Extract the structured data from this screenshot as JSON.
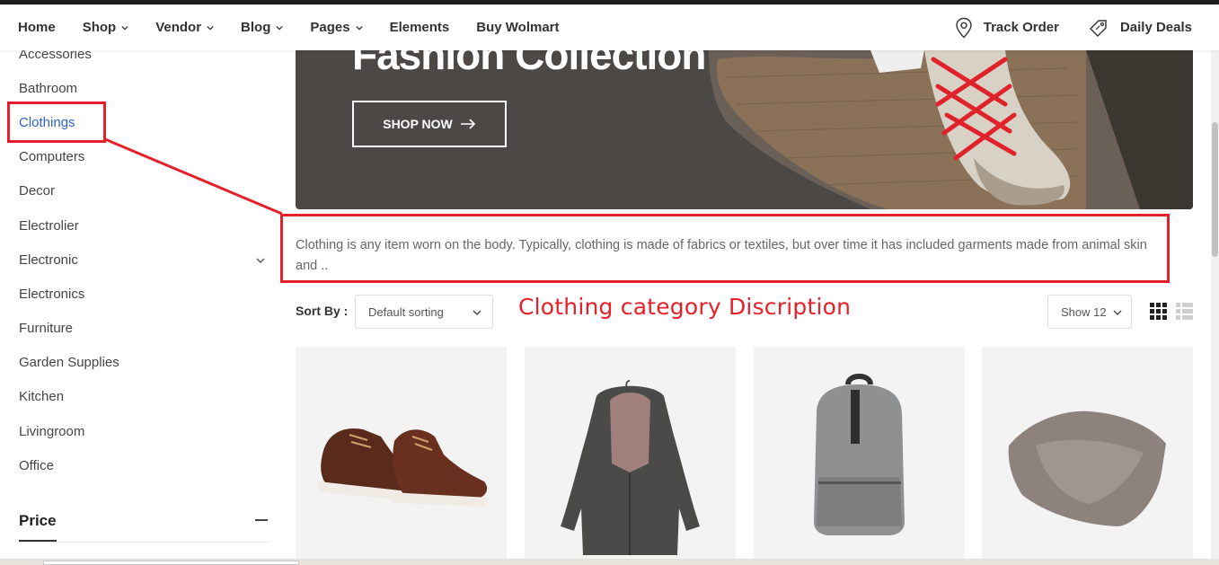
{
  "nav": {
    "items": [
      {
        "label": "Home",
        "has_dropdown": false
      },
      {
        "label": "Shop",
        "has_dropdown": true
      },
      {
        "label": "Vendor",
        "has_dropdown": true
      },
      {
        "label": "Blog",
        "has_dropdown": true
      },
      {
        "label": "Pages",
        "has_dropdown": true
      },
      {
        "label": "Elements",
        "has_dropdown": false
      },
      {
        "label": "Buy Wolmart",
        "has_dropdown": false
      }
    ],
    "track_order": "Track Order",
    "daily_deals": "Daily Deals"
  },
  "sidebar": {
    "categories": [
      {
        "label": "Accessories"
      },
      {
        "label": "Bathroom"
      },
      {
        "label": "Clothings",
        "active": true
      },
      {
        "label": "Computers"
      },
      {
        "label": "Decor"
      },
      {
        "label": "Electrolier"
      },
      {
        "label": "Electronic",
        "expandable": true
      },
      {
        "label": "Electronics"
      },
      {
        "label": "Furniture"
      },
      {
        "label": "Garden Supplies"
      },
      {
        "label": "Kitchen"
      },
      {
        "label": "Livingroom"
      },
      {
        "label": "Office"
      }
    ],
    "price_title": "Price"
  },
  "banner": {
    "title": "Fashion Collection",
    "button_label": "SHOP NOW"
  },
  "category_description": "Clothing is any item worn on the body. Typically, clothing is made of fabrics or textiles, but over time it has included garments made from animal skin and ..",
  "toolbar": {
    "sort_label": "Sort By :",
    "sort_value": "Default sorting",
    "show_value": "Show 12"
  },
  "annotation": {
    "label": "Clothing category Discription",
    "color": "#e5202a"
  },
  "products": [
    {
      "image": "brown-leather-boots"
    },
    {
      "image": "grey-hooded-coat"
    },
    {
      "image": "grey-backpack"
    },
    {
      "image": "grey-towel"
    }
  ],
  "colors": {
    "accent_blue": "#3361c9",
    "banner_bg": "#4b4845",
    "annotation_red": "#e5202a"
  }
}
